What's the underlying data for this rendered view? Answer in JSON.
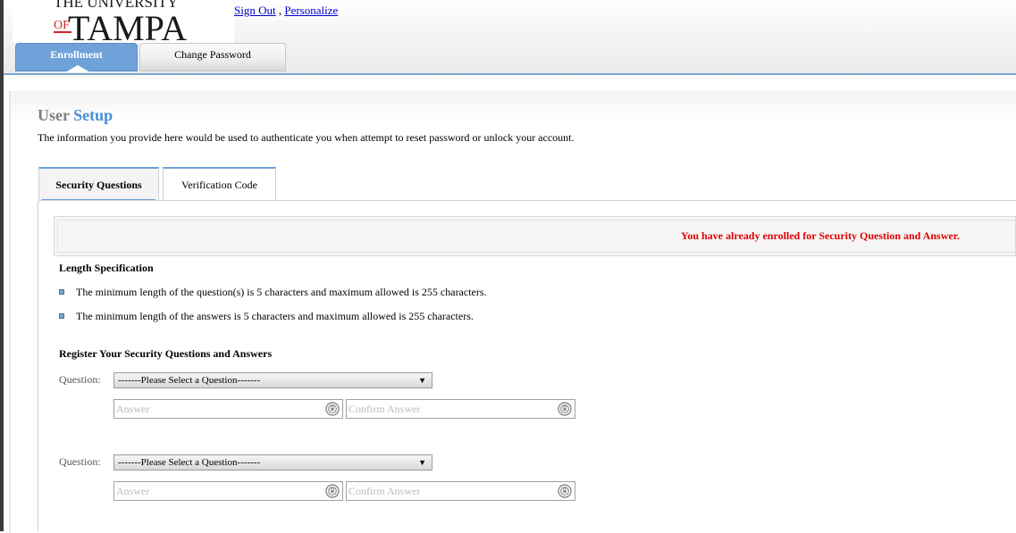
{
  "header": {
    "logo_line1": "THE UNIVERSITY",
    "logo_of": "OF",
    "logo_name": "TAMPA",
    "sign_out": "Sign Out",
    "separator": ",",
    "personalize": "Personalize"
  },
  "nav": {
    "tabs": [
      {
        "label": "Enrollment",
        "active": true
      },
      {
        "label": "Change Password",
        "active": false
      }
    ]
  },
  "page": {
    "title_part1": "User",
    "title_part2": "Setup",
    "description": "The information you provide here would be used to authenticate you when attempt to reset password or unlock your account."
  },
  "subtabs": [
    {
      "label": "Security Questions",
      "active": true
    },
    {
      "label": "Verification Code",
      "active": false
    }
  ],
  "notice": "You have already enrolled for Security Question and Answer.",
  "length_spec": {
    "heading": "Length Specification",
    "items": [
      "The minimum length of the question(s) is 5 characters and maximum allowed is 255 characters.",
      "The minimum length of the answers is 5 characters and maximum allowed is 255 characters."
    ]
  },
  "register": {
    "heading": "Register Your Security Questions and Answers",
    "questions": [
      {
        "label": "Question:",
        "selected": "-------Please Select a Question-------",
        "answer_placeholder": "Answer",
        "confirm_placeholder": "Confirm Answer"
      },
      {
        "label": "Question:",
        "selected": "-------Please Select a Question-------",
        "answer_placeholder": "Answer",
        "confirm_placeholder": "Confirm Answer"
      }
    ]
  },
  "colors": {
    "accent_blue": "#6ea2d9",
    "notice_red": "#e00000",
    "logo_red": "#d2232a"
  },
  "icons": [
    "dropdown-caret-icon",
    "show-password-icon",
    "bullet-square-icon"
  ]
}
